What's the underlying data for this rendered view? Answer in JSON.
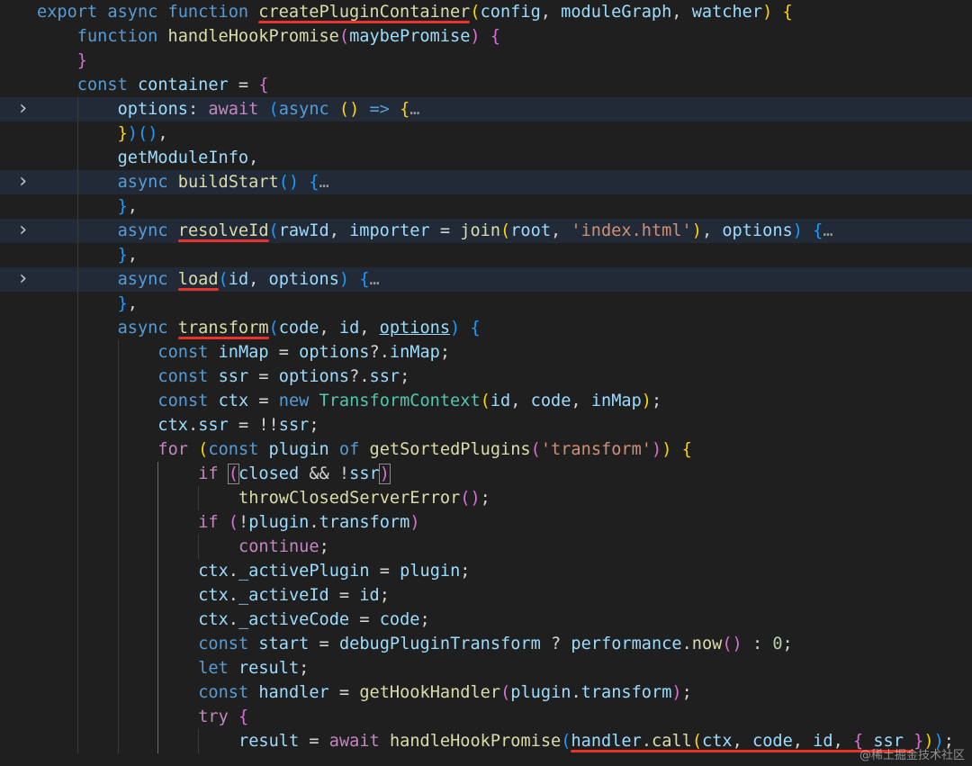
{
  "colors": {
    "background": "#1f1f1f",
    "keyword": "#569cd6",
    "control": "#c586c0",
    "function": "#dcdcaa",
    "variable": "#9cdcfe",
    "type": "#4ec9b0",
    "string": "#ce9178",
    "number": "#b5cea8",
    "plain": "#d4d4d4",
    "bracket1": "#ffd700",
    "bracket2": "#da70d6",
    "bracket3": "#179fff",
    "fold_ellipsis": "#9a9a9a",
    "annotation_underline": "#e8322a"
  },
  "icons": {
    "fold_collapsed": "chevron-right-icon"
  },
  "watermark": "@稀土掘金技术社区",
  "lines": [
    {
      "ind": 0,
      "tokens": [
        [
          "export ",
          "kw"
        ],
        [
          "async ",
          "kw"
        ],
        [
          "function ",
          "kw"
        ],
        [
          "createPluginContainer",
          "fn"
        ],
        [
          "(",
          "b1"
        ],
        [
          "config",
          "var"
        ],
        [
          ", ",
          "p"
        ],
        [
          "moduleGraph",
          "var"
        ],
        [
          ", ",
          "p"
        ],
        [
          "watcher",
          "var"
        ],
        [
          ")",
          "b1"
        ],
        [
          " ",
          "p"
        ],
        [
          "{",
          "b1"
        ]
      ]
    },
    {
      "ind": 1,
      "tokens": [
        [
          "function ",
          "kw"
        ],
        [
          "handleHookPromise",
          "fn"
        ],
        [
          "(",
          "b2"
        ],
        [
          "maybePromise",
          "var"
        ],
        [
          ")",
          "b2"
        ],
        [
          " ",
          "p"
        ],
        [
          "{",
          "b2"
        ]
      ]
    },
    {
      "ind": 1,
      "tokens": [
        [
          "}",
          "b2"
        ]
      ]
    },
    {
      "ind": 1,
      "tokens": [
        [
          "const ",
          "kw"
        ],
        [
          "container",
          "var"
        ],
        [
          " = ",
          "p"
        ],
        [
          "{",
          "b2"
        ]
      ]
    },
    {
      "ind": 2,
      "fold": true,
      "hl": true,
      "tokens": [
        [
          "options",
          "var"
        ],
        [
          ": ",
          "p"
        ],
        [
          "await ",
          "ctl"
        ],
        [
          "(",
          "b3"
        ],
        [
          "async ",
          "kw"
        ],
        [
          "()",
          "b1"
        ],
        [
          " => ",
          "kw"
        ],
        [
          "{",
          "b1"
        ],
        [
          "…",
          "ell"
        ]
      ]
    },
    {
      "ind": 2,
      "tokens": [
        [
          "}",
          "b1"
        ],
        [
          ")",
          "b3"
        ],
        [
          "()",
          "b3"
        ],
        [
          ",",
          "p"
        ]
      ]
    },
    {
      "ind": 2,
      "tokens": [
        [
          "getModuleInfo",
          "var"
        ],
        [
          ",",
          "p"
        ]
      ]
    },
    {
      "ind": 2,
      "fold": true,
      "hl": true,
      "tokens": [
        [
          "async ",
          "kw"
        ],
        [
          "buildStart",
          "fn"
        ],
        [
          "()",
          "b3"
        ],
        [
          " ",
          "p"
        ],
        [
          "{",
          "b3"
        ],
        [
          "…",
          "ell"
        ]
      ]
    },
    {
      "ind": 2,
      "tokens": [
        [
          "}",
          "b3"
        ],
        [
          ",",
          "p"
        ]
      ]
    },
    {
      "ind": 2,
      "fold": true,
      "hl": true,
      "tokens": [
        [
          "async ",
          "kw"
        ],
        [
          "resolveId",
          "fn"
        ],
        [
          "(",
          "b3"
        ],
        [
          "rawId",
          "var"
        ],
        [
          ", ",
          "p"
        ],
        [
          "importer",
          "var"
        ],
        [
          " = ",
          "p"
        ],
        [
          "join",
          "fn"
        ],
        [
          "(",
          "b1"
        ],
        [
          "root",
          "var"
        ],
        [
          ", ",
          "p"
        ],
        [
          "'index.html'",
          "str"
        ],
        [
          ")",
          "b1"
        ],
        [
          ", ",
          "p"
        ],
        [
          "options",
          "var"
        ],
        [
          ")",
          "b3"
        ],
        [
          " ",
          "p"
        ],
        [
          "{",
          "b3"
        ],
        [
          "…",
          "ell"
        ]
      ]
    },
    {
      "ind": 2,
      "tokens": [
        [
          "}",
          "b3"
        ],
        [
          ",",
          "p"
        ]
      ]
    },
    {
      "ind": 2,
      "fold": true,
      "hl": true,
      "tokens": [
        [
          "async ",
          "kw"
        ],
        [
          "load",
          "fn"
        ],
        [
          "(",
          "b3"
        ],
        [
          "id",
          "var"
        ],
        [
          ", ",
          "p"
        ],
        [
          "options",
          "var"
        ],
        [
          ")",
          "b3"
        ],
        [
          " ",
          "p"
        ],
        [
          "{",
          "b3"
        ],
        [
          "…",
          "ell"
        ]
      ]
    },
    {
      "ind": 2,
      "tokens": [
        [
          "}",
          "b3"
        ],
        [
          ",",
          "p"
        ]
      ]
    },
    {
      "ind": 2,
      "tokens": [
        [
          "async ",
          "kw"
        ],
        [
          "transform",
          "fn"
        ],
        [
          "(",
          "b3"
        ],
        [
          "code",
          "var"
        ],
        [
          ", ",
          "p"
        ],
        [
          "id",
          "var"
        ],
        [
          ", ",
          "p"
        ],
        [
          "options",
          "varu"
        ],
        [
          ")",
          "b3"
        ],
        [
          " ",
          "p"
        ],
        [
          "{",
          "b3"
        ]
      ]
    },
    {
      "ind": 3,
      "tokens": [
        [
          "const ",
          "kw"
        ],
        [
          "inMap",
          "var"
        ],
        [
          " = ",
          "p"
        ],
        [
          "options",
          "var"
        ],
        [
          "?.",
          "p"
        ],
        [
          "inMap",
          "var"
        ],
        [
          ";",
          "p"
        ]
      ]
    },
    {
      "ind": 3,
      "tokens": [
        [
          "const ",
          "kw"
        ],
        [
          "ssr",
          "var"
        ],
        [
          " = ",
          "p"
        ],
        [
          "options",
          "var"
        ],
        [
          "?.",
          "p"
        ],
        [
          "ssr",
          "var"
        ],
        [
          ";",
          "p"
        ]
      ]
    },
    {
      "ind": 3,
      "tokens": [
        [
          "const ",
          "kw"
        ],
        [
          "ctx",
          "var"
        ],
        [
          " = ",
          "p"
        ],
        [
          "new ",
          "kw"
        ],
        [
          "TransformContext",
          "type"
        ],
        [
          "(",
          "b1"
        ],
        [
          "id",
          "var"
        ],
        [
          ", ",
          "p"
        ],
        [
          "code",
          "var"
        ],
        [
          ", ",
          "p"
        ],
        [
          "inMap",
          "var"
        ],
        [
          ")",
          "b1"
        ],
        [
          ";",
          "p"
        ]
      ]
    },
    {
      "ind": 3,
      "tokens": [
        [
          "ctx",
          "var"
        ],
        [
          ".",
          "p"
        ],
        [
          "ssr",
          "var"
        ],
        [
          " = !!",
          "p"
        ],
        [
          "ssr",
          "var"
        ],
        [
          ";",
          "p"
        ]
      ]
    },
    {
      "ind": 3,
      "tokens": [
        [
          "for ",
          "ctl"
        ],
        [
          "(",
          "b1"
        ],
        [
          "const ",
          "kw"
        ],
        [
          "plugin ",
          "var"
        ],
        [
          "of ",
          "kw"
        ],
        [
          "getSortedPlugins",
          "fn"
        ],
        [
          "(",
          "b2"
        ],
        [
          "'transform'",
          "str"
        ],
        [
          ")",
          "b2"
        ],
        [
          ")",
          "b1"
        ],
        [
          " ",
          "p"
        ],
        [
          "{",
          "b1"
        ]
      ]
    },
    {
      "ind": 4,
      "cursor": true,
      "tokens": [
        [
          "if ",
          "ctl"
        ],
        [
          "(",
          "b2sel"
        ],
        [
          "closed",
          "var"
        ],
        [
          " && !",
          "p"
        ],
        [
          "ssr",
          "var"
        ],
        [
          ")",
          "b2sel"
        ]
      ]
    },
    {
      "ind": 5,
      "tokens": [
        [
          "throwClosedServerError",
          "fn"
        ],
        [
          "()",
          "b2"
        ],
        [
          ";",
          "p"
        ]
      ]
    },
    {
      "ind": 4,
      "tokens": [
        [
          "if ",
          "ctl"
        ],
        [
          "(",
          "b2"
        ],
        [
          "!",
          "p"
        ],
        [
          "plugin",
          "var"
        ],
        [
          ".",
          "p"
        ],
        [
          "transform",
          "var"
        ],
        [
          ")",
          "b2"
        ]
      ]
    },
    {
      "ind": 5,
      "tokens": [
        [
          "continue",
          "ctl"
        ],
        [
          ";",
          "p"
        ]
      ]
    },
    {
      "ind": 4,
      "tokens": [
        [
          "ctx",
          "var"
        ],
        [
          ".",
          "p"
        ],
        [
          "_activePlugin",
          "var"
        ],
        [
          " = ",
          "p"
        ],
        [
          "plugin",
          "var"
        ],
        [
          ";",
          "p"
        ]
      ]
    },
    {
      "ind": 4,
      "tokens": [
        [
          "ctx",
          "var"
        ],
        [
          ".",
          "p"
        ],
        [
          "_activeId",
          "var"
        ],
        [
          " = ",
          "p"
        ],
        [
          "id",
          "var"
        ],
        [
          ";",
          "p"
        ]
      ]
    },
    {
      "ind": 4,
      "tokens": [
        [
          "ctx",
          "var"
        ],
        [
          ".",
          "p"
        ],
        [
          "_activeCode",
          "var"
        ],
        [
          " = ",
          "p"
        ],
        [
          "code",
          "var"
        ],
        [
          ";",
          "p"
        ]
      ]
    },
    {
      "ind": 4,
      "tokens": [
        [
          "const ",
          "kw"
        ],
        [
          "start",
          "var"
        ],
        [
          " = ",
          "p"
        ],
        [
          "debugPluginTransform",
          "var"
        ],
        [
          " ? ",
          "p"
        ],
        [
          "performance",
          "var"
        ],
        [
          ".",
          "p"
        ],
        [
          "now",
          "fn"
        ],
        [
          "()",
          "b2"
        ],
        [
          " : ",
          "p"
        ],
        [
          "0",
          "num"
        ],
        [
          ";",
          "p"
        ]
      ]
    },
    {
      "ind": 4,
      "tokens": [
        [
          "let ",
          "kw"
        ],
        [
          "result",
          "var"
        ],
        [
          ";",
          "p"
        ]
      ]
    },
    {
      "ind": 4,
      "tokens": [
        [
          "const ",
          "kw"
        ],
        [
          "handler",
          "var"
        ],
        [
          " = ",
          "p"
        ],
        [
          "getHookHandler",
          "fn"
        ],
        [
          "(",
          "b2"
        ],
        [
          "plugin",
          "var"
        ],
        [
          ".",
          "p"
        ],
        [
          "transform",
          "var"
        ],
        [
          ")",
          "b2"
        ],
        [
          ";",
          "p"
        ]
      ]
    },
    {
      "ind": 4,
      "tokens": [
        [
          "try ",
          "ctl"
        ],
        [
          "{",
          "b2"
        ]
      ]
    },
    {
      "ind": 5,
      "tokens": [
        [
          "result",
          "var"
        ],
        [
          " = ",
          "p"
        ],
        [
          "await ",
          "ctl"
        ],
        [
          "handleHookPromise",
          "fn"
        ],
        [
          "(",
          "b3"
        ],
        [
          "handler",
          "var"
        ],
        [
          ".",
          "p"
        ],
        [
          "call",
          "fn"
        ],
        [
          "(",
          "b1"
        ],
        [
          "ctx",
          "var"
        ],
        [
          ", ",
          "p"
        ],
        [
          "code",
          "var"
        ],
        [
          ", ",
          "p"
        ],
        [
          "id",
          "var"
        ],
        [
          ", ",
          "p"
        ],
        [
          "{",
          "b2"
        ],
        [
          " ",
          "p"
        ],
        [
          "ssr",
          "var"
        ],
        [
          " ",
          "p"
        ],
        [
          "}",
          "b2"
        ],
        [
          ")",
          "b1"
        ],
        [
          ")",
          "b3"
        ],
        [
          ";",
          "p"
        ]
      ]
    }
  ]
}
